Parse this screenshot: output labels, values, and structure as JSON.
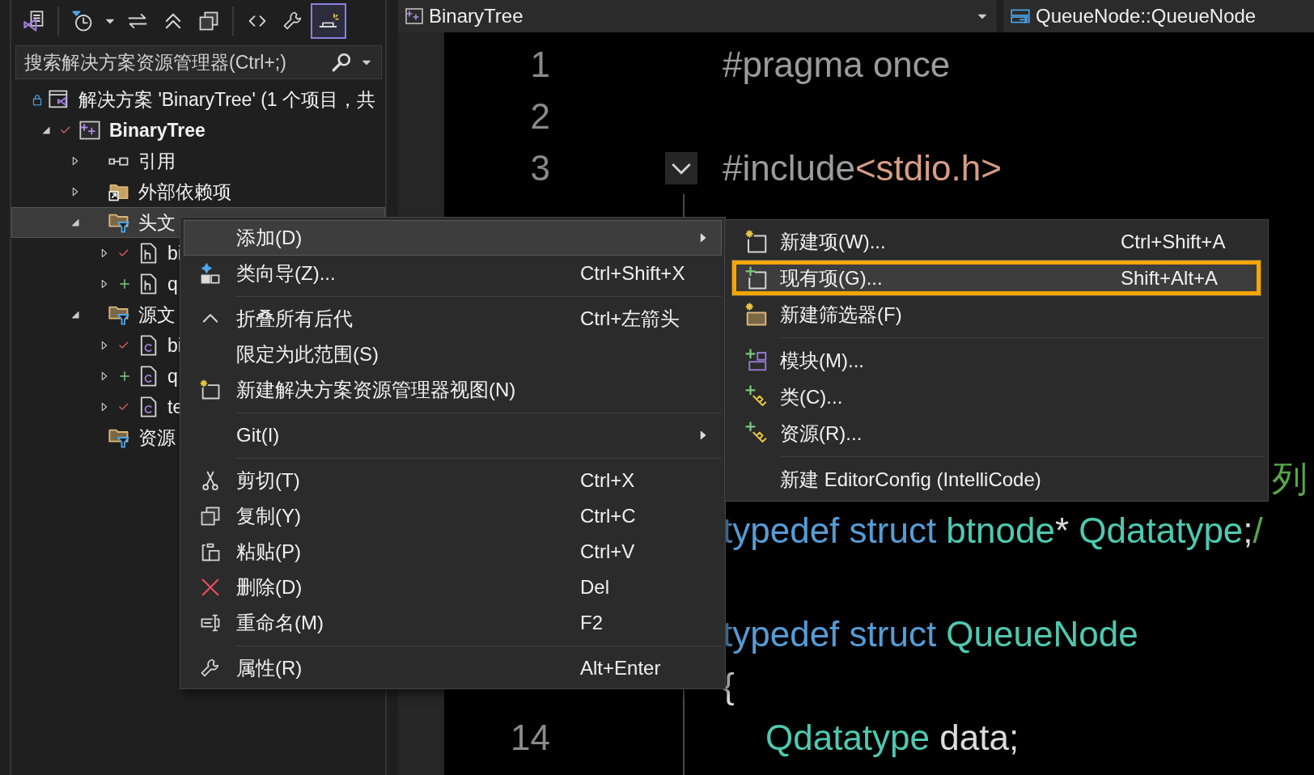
{
  "toolbar": [
    {
      "kind": "solution-view",
      "pressed": false
    },
    {
      "kind": "separator"
    },
    {
      "kind": "history",
      "pressed": false
    },
    {
      "kind": "dropdown",
      "pressed": false
    },
    {
      "kind": "sync",
      "pressed": false
    },
    {
      "kind": "collapse",
      "pressed": false
    },
    {
      "kind": "copy",
      "pressed": false
    },
    {
      "kind": "separator"
    },
    {
      "kind": "code",
      "pressed": false
    },
    {
      "kind": "properties",
      "pressed": false
    },
    {
      "kind": "preview",
      "pressed": true
    }
  ],
  "search": {
    "placeholder": "搜索解决方案资源管理器(Ctrl+;)"
  },
  "tree": [
    {
      "kind": "solution",
      "label": "解决方案 'BinaryTree' (1 个项目，共",
      "selected": false,
      "children": [
        {
          "kind": "project",
          "label": "BinaryTree",
          "expanded": true,
          "added": false,
          "selected": false,
          "children": [
            {
              "kind": "references",
              "label": "引用",
              "expanded": false,
              "selected": false
            },
            {
              "kind": "external",
              "label": "外部依赖项",
              "expanded": false,
              "selected": false
            },
            {
              "kind": "filter",
              "label": "头文",
              "expanded": true,
              "selected": true,
              "children": [
                {
                  "kind": "header",
                  "label": "bi",
                  "expanded": false,
                  "added": false,
                  "selected": false
                },
                {
                  "kind": "header",
                  "label": "q",
                  "expanded": false,
                  "added": true,
                  "selected": false
                }
              ]
            },
            {
              "kind": "filter",
              "label": "源文",
              "expanded": true,
              "selected": false,
              "children": [
                {
                  "kind": "source",
                  "label": "bi",
                  "expanded": false,
                  "added": false,
                  "selected": false
                },
                {
                  "kind": "source",
                  "label": "q",
                  "expanded": false,
                  "added": true,
                  "selected": false
                },
                {
                  "kind": "source",
                  "label": "te",
                  "expanded": false,
                  "added": false,
                  "selected": false
                }
              ]
            },
            {
              "kind": "filter",
              "label": "资源",
              "selected": false
            }
          ]
        }
      ]
    }
  ],
  "editor": {
    "project": "BinaryTree",
    "member": "QueueNode::QueueNode",
    "lines": [
      {
        "number": "1",
        "kind": "code",
        "tokens": [
          {
            "kind": "preprocessor",
            "text": "#pragma once"
          }
        ]
      },
      {
        "number": "2",
        "kind": "code"
      },
      {
        "number": "3",
        "kind": "code",
        "fold": true,
        "tokens": [
          {
            "kind": "preprocessor",
            "text": "#include"
          },
          {
            "kind": "string",
            "text": "<stdio.h>"
          }
        ]
      },
      {
        "kind": "code"
      },
      {
        "kind": "code"
      },
      {
        "kind": "code"
      },
      {
        "kind": "code"
      },
      {
        "kind": "code"
      },
      {
        "kind": "tail",
        "tokens": [
          {
            "kind": "comment",
            "text": "列"
          }
        ]
      },
      {
        "kind": "code",
        "tokens": [
          {
            "kind": "keyword",
            "text": "typedef struct "
          },
          {
            "kind": "type",
            "text": "btnode"
          },
          {
            "kind": "plain",
            "text": "* "
          },
          {
            "kind": "type",
            "text": "Qdatatype"
          },
          {
            "kind": "plain",
            "text": ";"
          },
          {
            "kind": "comment",
            "text": "/"
          }
        ]
      },
      {
        "kind": "code"
      },
      {
        "kind": "code",
        "tokens": [
          {
            "kind": "keyword",
            "text": "typedef struct "
          },
          {
            "kind": "type",
            "text": "QueueNode"
          }
        ]
      },
      {
        "kind": "code",
        "tokens": [
          {
            "kind": "plain",
            "text": "{"
          }
        ]
      },
      {
        "number": "14",
        "kind": "indented",
        "tokens": [
          {
            "kind": "type",
            "text": "Qdatatype"
          },
          {
            "kind": "plain",
            "text": " data;"
          }
        ]
      }
    ]
  },
  "context_menu": {
    "items": [
      {
        "kind": "item",
        "label": "添加(D)",
        "submenu": true,
        "selected": true
      },
      {
        "kind": "item",
        "label": "类向导(Z)...",
        "shortcut": "Ctrl+Shift+X",
        "submenu": false,
        "selected": false
      },
      {
        "kind": "separator"
      },
      {
        "kind": "item",
        "label": "折叠所有后代",
        "shortcut": "Ctrl+左箭头",
        "submenu": false,
        "selected": false
      },
      {
        "kind": "item",
        "label": "限定为此范围(S)",
        "submenu": false,
        "selected": false
      },
      {
        "kind": "item",
        "label": "新建解决方案资源管理器视图(N)",
        "submenu": false,
        "selected": false
      },
      {
        "kind": "separator"
      },
      {
        "kind": "item",
        "label": "Git(I)",
        "submenu": true,
        "selected": false
      },
      {
        "kind": "separator"
      },
      {
        "kind": "item",
        "label": "剪切(T)",
        "shortcut": "Ctrl+X",
        "submenu": false,
        "selected": false
      },
      {
        "kind": "item",
        "label": "复制(Y)",
        "shortcut": "Ctrl+C",
        "submenu": false,
        "selected": false
      },
      {
        "kind": "item",
        "label": "粘贴(P)",
        "shortcut": "Ctrl+V",
        "submenu": false,
        "selected": false
      },
      {
        "kind": "item",
        "label": "删除(D)",
        "shortcut": "Del",
        "submenu": false,
        "selected": false
      },
      {
        "kind": "item",
        "label": "重命名(M)",
        "shortcut": "F2",
        "submenu": false,
        "selected": false
      },
      {
        "kind": "separator"
      },
      {
        "kind": "item",
        "label": "属性(R)",
        "shortcut": "Alt+Enter",
        "submenu": false,
        "selected": false
      }
    ]
  },
  "submenu": {
    "items": [
      {
        "kind": "item",
        "label": "新建项(W)...",
        "shortcut": "Ctrl+Shift+A",
        "selected": false,
        "annotated": false
      },
      {
        "kind": "item",
        "label": "现有项(G)...",
        "shortcut": "Shift+Alt+A",
        "selected": true,
        "annotated": true
      },
      {
        "kind": "item",
        "label": "新建筛选器(F)",
        "selected": false,
        "annotated": false
      },
      {
        "kind": "separator"
      },
      {
        "kind": "item",
        "label": "模块(M)...",
        "selected": false,
        "annotated": false
      },
      {
        "kind": "item",
        "label": "类(C)...",
        "selected": false,
        "annotated": false
      },
      {
        "kind": "item",
        "label": "资源(R)...",
        "selected": false,
        "annotated": false
      },
      {
        "kind": "separator"
      },
      {
        "kind": "item",
        "label": "新建 EditorConfig (IntelliCode)",
        "selected": false,
        "annotated": false
      }
    ]
  }
}
